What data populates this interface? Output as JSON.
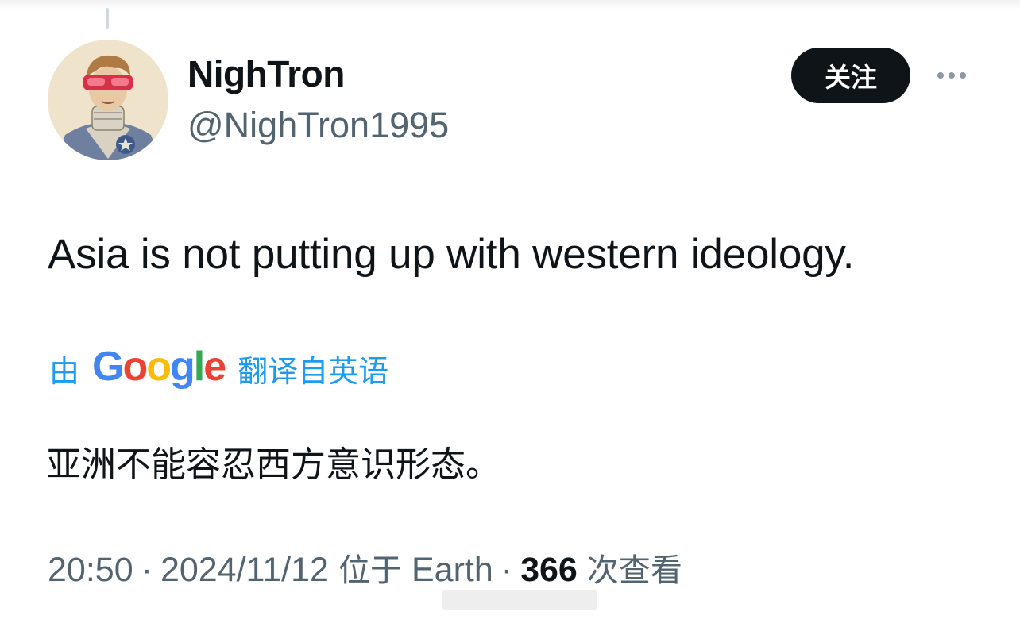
{
  "user": {
    "display_name": "NighTron",
    "handle": "@NighTron1995",
    "avatar_icon": "avatar-illustration"
  },
  "actions": {
    "follow_label": "关注",
    "more_icon": "more-horizontal-icon"
  },
  "tweet": {
    "text": "Asia is not putting up with western ideology."
  },
  "translation": {
    "prefix": "由",
    "provider": [
      "G",
      "o",
      "o",
      "g",
      "l",
      "e"
    ],
    "suffix": "翻译自英语",
    "text": "亚洲不能容忍西方意识形态。"
  },
  "meta": {
    "time": "20:50",
    "date": "2024/11/12",
    "location_prefix": "位于",
    "location": "Earth",
    "separator": "·",
    "views_count": "366",
    "views_label": "次查看"
  },
  "colors": {
    "text_primary": "#0f1419",
    "text_secondary": "#536471",
    "link_blue": "#1d9bf0",
    "button_bg": "#0f1419",
    "google_blue": "#4285F4",
    "google_red": "#EA4335",
    "google_yellow": "#FBBC05",
    "google_green": "#34A853"
  }
}
